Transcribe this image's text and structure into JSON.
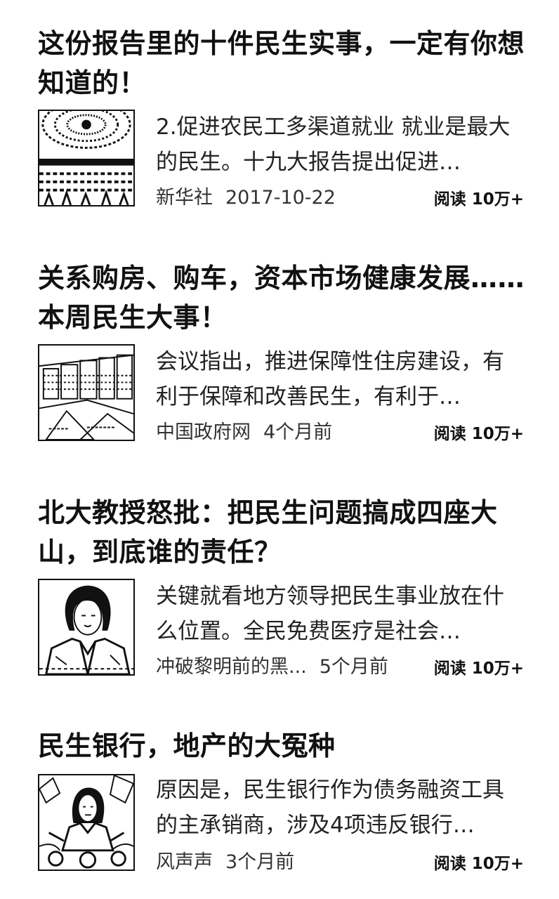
{
  "articles": [
    {
      "title": "这份报告里的十件民生实事，一定有你想知道的！",
      "summary": "2.促进农民工多渠道就业 就业是最大的民生。十九大报告提出促进…",
      "source": "新华社",
      "date": "2017-10-22",
      "reads_label": "阅读",
      "reads_count": "10万+",
      "thumb_icon": "assembly-hall-image"
    },
    {
      "title": "关系购房、购车，资本市场健康发展……本周民生大事！",
      "summary": "会议指出，推进保障性住房建设，有利于保障和改善民生，有利于…",
      "source": "中国政府网",
      "date": "4个月前",
      "reads_label": "阅读",
      "reads_count": "10万+",
      "thumb_icon": "housing-buildings-image"
    },
    {
      "title": "北大教授怒批：把民生问题搞成四座大山，到底谁的责任？",
      "summary": "关键就看地方领导把民生事业放在什么位置。全民免费医疗是社会…",
      "source": "冲破黎明前的黑...",
      "date": "5个月前",
      "reads_label": "阅读",
      "reads_count": "10万+",
      "thumb_icon": "professor-portrait-image"
    },
    {
      "title": "民生银行，地产的大冤种",
      "summary": "原因是，民生银行作为债务融资工具的主承销商，涉及4项违反银行…",
      "source": "风声声",
      "date": "3个月前",
      "reads_label": "阅读",
      "reads_count": "10万+",
      "thumb_icon": "figure-painting-image"
    }
  ]
}
